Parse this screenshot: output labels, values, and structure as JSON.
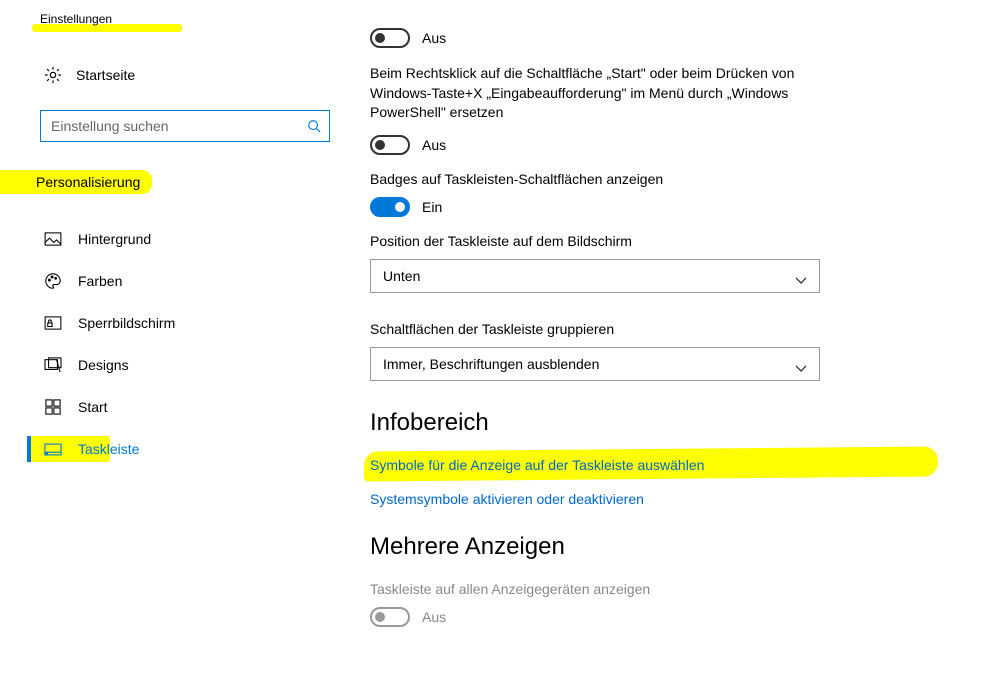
{
  "window": {
    "title": "Einstellungen"
  },
  "sidebar": {
    "home_label": "Startseite",
    "search_placeholder": "Einstellung suchen",
    "category": "Personalisierung",
    "items": [
      {
        "label": "Hintergrund"
      },
      {
        "label": "Farben"
      },
      {
        "label": "Sperrbildschirm"
      },
      {
        "label": "Designs"
      },
      {
        "label": "Start"
      },
      {
        "label": "Taskleiste"
      }
    ]
  },
  "main": {
    "toggle1": {
      "state": "Aus",
      "on": false
    },
    "powershell_desc": "Beim Rechtsklick auf die Schaltfläche „Start\" oder beim Drücken von Windows-Taste+X „Eingabeaufforderung\" im Menü durch „Windows PowerShell\" ersetzen",
    "toggle2": {
      "state": "Aus",
      "on": false
    },
    "badges_label": "Badges auf Taskleisten-Schaltflächen anzeigen",
    "toggle_badges": {
      "state": "Ein",
      "on": true
    },
    "position_label": "Position der Taskleiste auf dem Bildschirm",
    "position_value": "Unten",
    "group_label": "Schaltflächen der Taskleiste gruppieren",
    "group_value": "Immer, Beschriftungen ausblenden",
    "section_info": "Infobereich",
    "link_select_icons": "Symbole für die Anzeige auf der Taskleiste auswählen",
    "link_system_icons": "Systemsymbole aktivieren oder deaktivieren",
    "section_multi": "Mehrere Anzeigen",
    "multi_label": "Taskleiste auf allen Anzeigegeräten anzeigen",
    "toggle_multi": {
      "state": "Aus",
      "on": false
    }
  }
}
